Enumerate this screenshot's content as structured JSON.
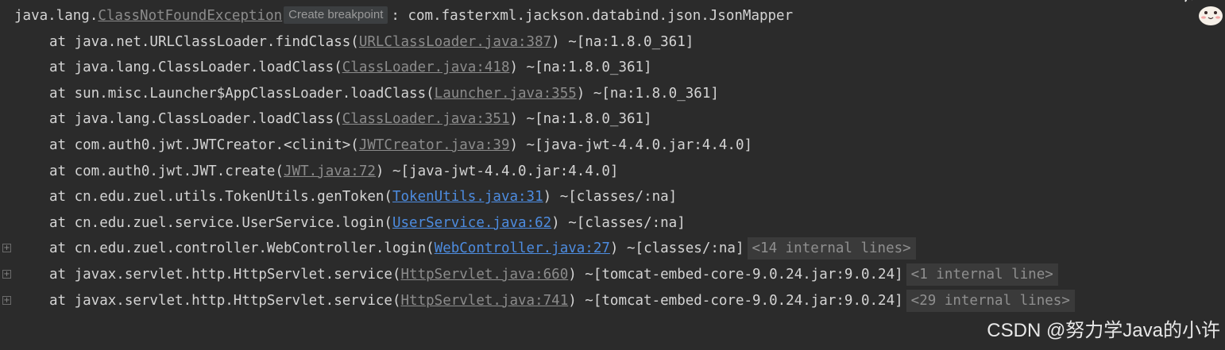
{
  "header": {
    "prefix": "java.lang.",
    "exception_link": "ClassNotFoundException",
    "tooltip": "Create breakpoint",
    "message": ": com.fasterxml.jackson.databind.json.JsonMapper"
  },
  "frames": [
    {
      "pre": "at java.net.URLClassLoader.findClass(",
      "link": "URLClassLoader.java:387",
      "post": ") ~[na:1.8.0_361]"
    },
    {
      "pre": "at java.lang.ClassLoader.loadClass(",
      "link": "ClassLoader.java:418",
      "post": ") ~[na:1.8.0_361]"
    },
    {
      "pre": "at sun.misc.Launcher$AppClassLoader.loadClass(",
      "link": "Launcher.java:355",
      "post": ") ~[na:1.8.0_361]"
    },
    {
      "pre": "at java.lang.ClassLoader.loadClass(",
      "link": "ClassLoader.java:351",
      "post": ") ~[na:1.8.0_361]"
    },
    {
      "pre": "at com.auth0.jwt.JWTCreator.<clinit>(",
      "link": "JWTCreator.java:39",
      "post": ") ~[java-jwt-4.4.0.jar:4.4.0]"
    },
    {
      "pre": "at com.auth0.jwt.JWT.create(",
      "link": "JWT.java:72",
      "post": ") ~[java-jwt-4.4.0.jar:4.4.0]"
    },
    {
      "pre": "at cn.edu.zuel.utils.TokenUtils.genToken(",
      "link": "TokenUtils.java:31",
      "post": ") ~[classes/:na]"
    },
    {
      "pre": "at cn.edu.zuel.service.UserService.login(",
      "link": "UserService.java:62",
      "post": ") ~[classes/:na]"
    },
    {
      "pre": "at cn.edu.zuel.controller.WebController.login(",
      "link": "WebController.java:27",
      "post": ") ~[classes/:na]",
      "internal": "<14 internal lines>"
    },
    {
      "pre": "at javax.servlet.http.HttpServlet.service(",
      "link": "HttpServlet.java:660",
      "post": ") ~[tomcat-embed-core-9.0.24.jar:9.0.24]",
      "internal": "<1 internal line>"
    },
    {
      "pre": "at javax.servlet.http.HttpServlet.service(",
      "link": "HttpServlet.java:741",
      "post": ") ~[tomcat-embed-core-9.0.24.jar:9.0.24]",
      "internal": "<29 internal lines>"
    }
  ],
  "fold_icon": "+",
  "watermark": "CSDN @努力学Java的小许",
  "colors": {
    "background": "#2b2b2b",
    "text": "#d4d4d4",
    "library_link": "#8c8c8c",
    "project_link": "#4d8ce0",
    "internal_badge_bg": "#3a3a3a"
  }
}
